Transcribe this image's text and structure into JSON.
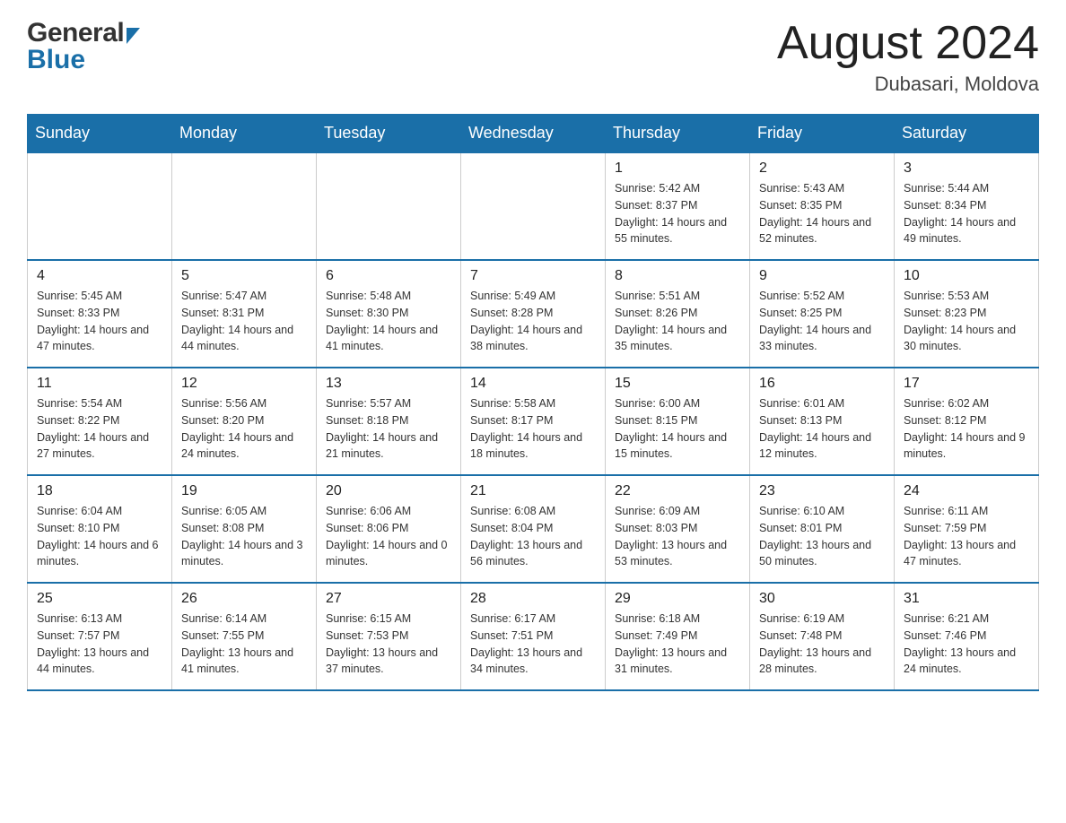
{
  "header": {
    "month_title": "August 2024",
    "location": "Dubasari, Moldova"
  },
  "calendar": {
    "days_of_week": [
      "Sunday",
      "Monday",
      "Tuesday",
      "Wednesday",
      "Thursday",
      "Friday",
      "Saturday"
    ],
    "weeks": [
      [
        {
          "day": "",
          "info": ""
        },
        {
          "day": "",
          "info": ""
        },
        {
          "day": "",
          "info": ""
        },
        {
          "day": "",
          "info": ""
        },
        {
          "day": "1",
          "info": "Sunrise: 5:42 AM\nSunset: 8:37 PM\nDaylight: 14 hours and 55 minutes."
        },
        {
          "day": "2",
          "info": "Sunrise: 5:43 AM\nSunset: 8:35 PM\nDaylight: 14 hours and 52 minutes."
        },
        {
          "day": "3",
          "info": "Sunrise: 5:44 AM\nSunset: 8:34 PM\nDaylight: 14 hours and 49 minutes."
        }
      ],
      [
        {
          "day": "4",
          "info": "Sunrise: 5:45 AM\nSunset: 8:33 PM\nDaylight: 14 hours and 47 minutes."
        },
        {
          "day": "5",
          "info": "Sunrise: 5:47 AM\nSunset: 8:31 PM\nDaylight: 14 hours and 44 minutes."
        },
        {
          "day": "6",
          "info": "Sunrise: 5:48 AM\nSunset: 8:30 PM\nDaylight: 14 hours and 41 minutes."
        },
        {
          "day": "7",
          "info": "Sunrise: 5:49 AM\nSunset: 8:28 PM\nDaylight: 14 hours and 38 minutes."
        },
        {
          "day": "8",
          "info": "Sunrise: 5:51 AM\nSunset: 8:26 PM\nDaylight: 14 hours and 35 minutes."
        },
        {
          "day": "9",
          "info": "Sunrise: 5:52 AM\nSunset: 8:25 PM\nDaylight: 14 hours and 33 minutes."
        },
        {
          "day": "10",
          "info": "Sunrise: 5:53 AM\nSunset: 8:23 PM\nDaylight: 14 hours and 30 minutes."
        }
      ],
      [
        {
          "day": "11",
          "info": "Sunrise: 5:54 AM\nSunset: 8:22 PM\nDaylight: 14 hours and 27 minutes."
        },
        {
          "day": "12",
          "info": "Sunrise: 5:56 AM\nSunset: 8:20 PM\nDaylight: 14 hours and 24 minutes."
        },
        {
          "day": "13",
          "info": "Sunrise: 5:57 AM\nSunset: 8:18 PM\nDaylight: 14 hours and 21 minutes."
        },
        {
          "day": "14",
          "info": "Sunrise: 5:58 AM\nSunset: 8:17 PM\nDaylight: 14 hours and 18 minutes."
        },
        {
          "day": "15",
          "info": "Sunrise: 6:00 AM\nSunset: 8:15 PM\nDaylight: 14 hours and 15 minutes."
        },
        {
          "day": "16",
          "info": "Sunrise: 6:01 AM\nSunset: 8:13 PM\nDaylight: 14 hours and 12 minutes."
        },
        {
          "day": "17",
          "info": "Sunrise: 6:02 AM\nSunset: 8:12 PM\nDaylight: 14 hours and 9 minutes."
        }
      ],
      [
        {
          "day": "18",
          "info": "Sunrise: 6:04 AM\nSunset: 8:10 PM\nDaylight: 14 hours and 6 minutes."
        },
        {
          "day": "19",
          "info": "Sunrise: 6:05 AM\nSunset: 8:08 PM\nDaylight: 14 hours and 3 minutes."
        },
        {
          "day": "20",
          "info": "Sunrise: 6:06 AM\nSunset: 8:06 PM\nDaylight: 14 hours and 0 minutes."
        },
        {
          "day": "21",
          "info": "Sunrise: 6:08 AM\nSunset: 8:04 PM\nDaylight: 13 hours and 56 minutes."
        },
        {
          "day": "22",
          "info": "Sunrise: 6:09 AM\nSunset: 8:03 PM\nDaylight: 13 hours and 53 minutes."
        },
        {
          "day": "23",
          "info": "Sunrise: 6:10 AM\nSunset: 8:01 PM\nDaylight: 13 hours and 50 minutes."
        },
        {
          "day": "24",
          "info": "Sunrise: 6:11 AM\nSunset: 7:59 PM\nDaylight: 13 hours and 47 minutes."
        }
      ],
      [
        {
          "day": "25",
          "info": "Sunrise: 6:13 AM\nSunset: 7:57 PM\nDaylight: 13 hours and 44 minutes."
        },
        {
          "day": "26",
          "info": "Sunrise: 6:14 AM\nSunset: 7:55 PM\nDaylight: 13 hours and 41 minutes."
        },
        {
          "day": "27",
          "info": "Sunrise: 6:15 AM\nSunset: 7:53 PM\nDaylight: 13 hours and 37 minutes."
        },
        {
          "day": "28",
          "info": "Sunrise: 6:17 AM\nSunset: 7:51 PM\nDaylight: 13 hours and 34 minutes."
        },
        {
          "day": "29",
          "info": "Sunrise: 6:18 AM\nSunset: 7:49 PM\nDaylight: 13 hours and 31 minutes."
        },
        {
          "day": "30",
          "info": "Sunrise: 6:19 AM\nSunset: 7:48 PM\nDaylight: 13 hours and 28 minutes."
        },
        {
          "day": "31",
          "info": "Sunrise: 6:21 AM\nSunset: 7:46 PM\nDaylight: 13 hours and 24 minutes."
        }
      ]
    ]
  }
}
